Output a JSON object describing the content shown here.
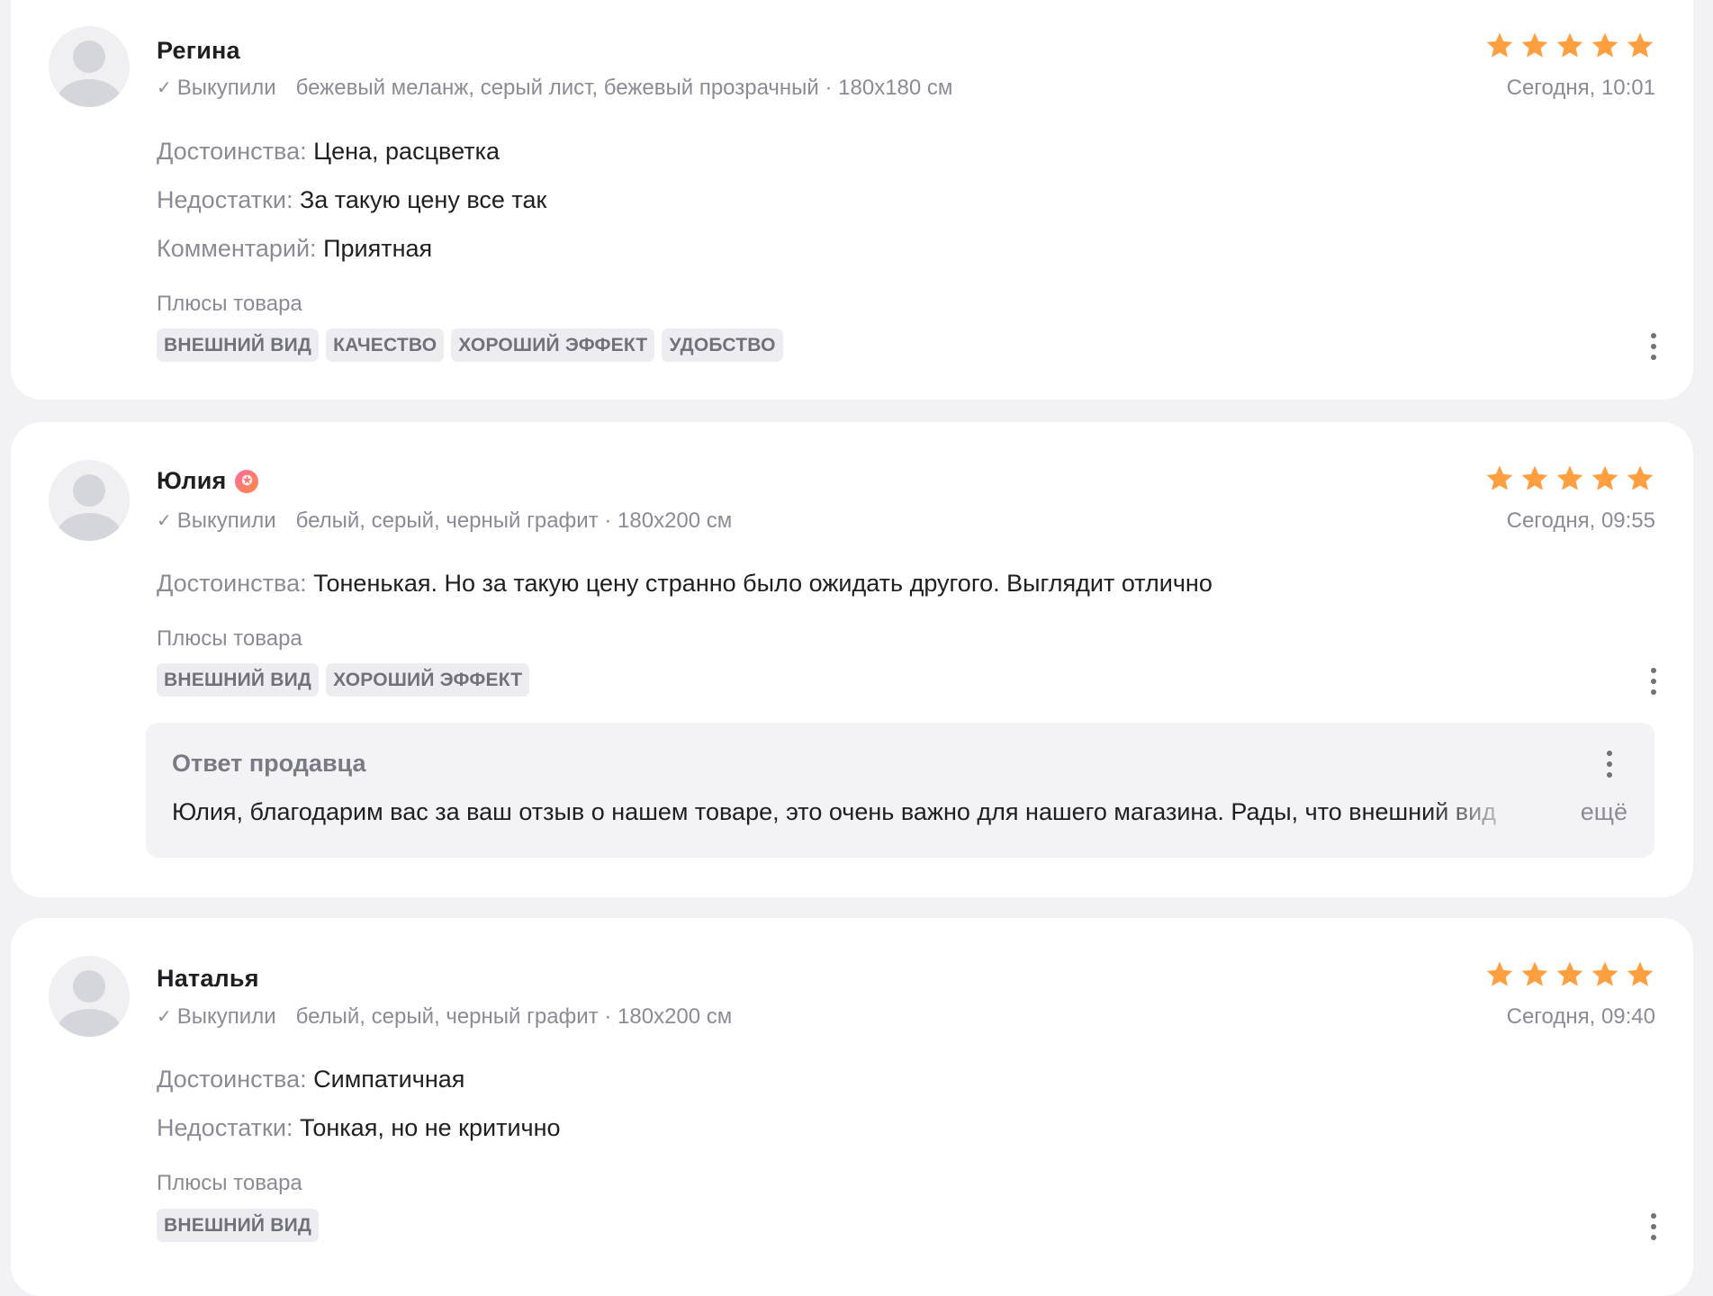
{
  "reviews": [
    {
      "name": "Регина",
      "has_badge": false,
      "bought_label": "Выкупили",
      "variant": "бежевый меланж, серый лист, бежевый прозрачный · 180x180 см",
      "rating": 5,
      "date": "Сегодня, 10:01",
      "fields": [
        {
          "label": "Достоинства:",
          "value": "Цена, расцветка"
        },
        {
          "label": "Недостатки:",
          "value": "За такую цену все так"
        },
        {
          "label": "Комментарий:",
          "value": "Приятная"
        }
      ],
      "plus_title": "Плюсы товара",
      "tags": [
        "ВНЕШНИЙ ВИД",
        "КАЧЕСТВО",
        "ХОРОШИЙ ЭФФЕКТ",
        "УДОБСТВО"
      ]
    },
    {
      "name": "Юлия",
      "has_badge": true,
      "bought_label": "Выкупили",
      "variant": "белый, серый, черный графит · 180x200 см",
      "rating": 5,
      "date": "Сегодня, 09:55",
      "fields": [
        {
          "label": "Достоинства:",
          "value": "Тоненькая. Но за такую цену странно было ожидать другого. Выглядит отлично"
        }
      ],
      "plus_title": "Плюсы товара",
      "tags": [
        "ВНЕШНИЙ ВИД",
        "ХОРОШИЙ ЭФФЕКТ"
      ],
      "seller_answer": {
        "title": "Ответ продавца",
        "text": "Юлия, благодарим вас за ваш отзыв о нашем товаре, это очень важно для нашего магазина. Рады, что внешний вид",
        "more_label": "ещё"
      }
    },
    {
      "name": "Наталья",
      "has_badge": false,
      "bought_label": "Выкупили",
      "variant": "белый, серый, черный графит · 180x200 см",
      "rating": 5,
      "date": "Сегодня, 09:40",
      "fields": [
        {
          "label": "Достоинства:",
          "value": "Симпатичная"
        },
        {
          "label": "Недостатки:",
          "value": "Тонкая, но не критично"
        }
      ],
      "plus_title": "Плюсы товара",
      "tags": [
        "ВНЕШНИЙ ВИД"
      ]
    }
  ],
  "colors": {
    "star": "#ff9f40",
    "badge_gradient_start": "#ff6aa6",
    "badge_gradient_end": "#ff8a3d",
    "card_background": "#ffffff",
    "page_background": "#f2f2f5",
    "tag_background": "#ececf1"
  },
  "icons": {
    "check": "check-icon",
    "star": "star-icon",
    "more": "more-vertical-icon",
    "badge": "star-badge-icon",
    "avatar": "user-avatar-icon"
  }
}
